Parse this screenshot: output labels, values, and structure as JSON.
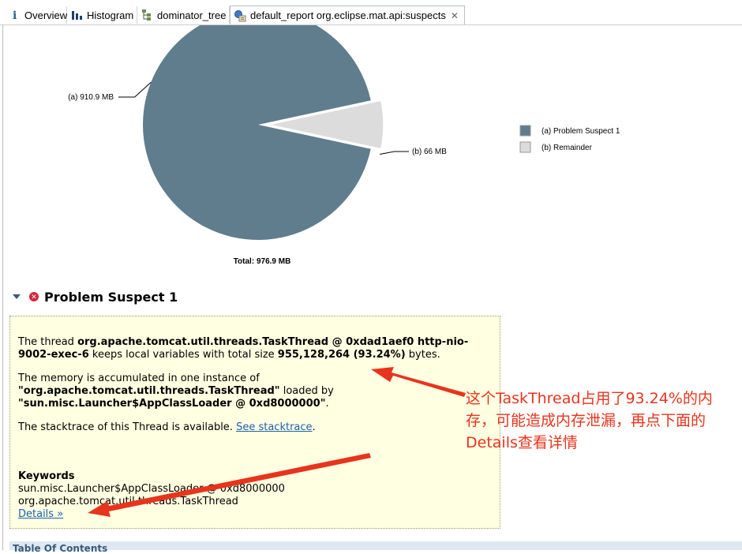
{
  "tabs": [
    {
      "label": "Overview",
      "icon": "info-icon"
    },
    {
      "label": "Histogram",
      "icon": "histogram-icon"
    },
    {
      "label": "dominator_tree",
      "icon": "tree-icon"
    },
    {
      "label": "default_report  org.eclipse.mat.api:suspects",
      "icon": "report-icon",
      "active": true,
      "closable": true
    }
  ],
  "chart": {
    "total_label": "Total: 976.9 MB",
    "colors": {
      "suspect": "#607d8d",
      "remainder": "#dcdcdc"
    }
  },
  "chart_data": {
    "type": "pie",
    "slices": [
      {
        "label": "(a)  910.9 MB",
        "legend": "(a)  Problem Suspect 1",
        "value": 910.9
      },
      {
        "label": "(b)  66 MB",
        "legend": "(b)  Remainder",
        "value": 66
      }
    ],
    "total": "Total: 976.9 MB",
    "legend_position": "right"
  },
  "problem_suspect": {
    "title": "Problem Suspect 1",
    "p1_a": "The thread ",
    "p1_b": "org.apache.tomcat.util.threads.TaskThread @ 0xdad1aef0 http-nio-9002-exec-6",
    "p1_c": " keeps local variables with total size ",
    "p1_d": "955,128,264 (93.24%)",
    "p1_e": " bytes.",
    "p2_a": "The memory is accumulated in one instance of ",
    "p2_b": "\"org.apache.tomcat.util.threads.TaskThread\"",
    "p2_c": " loaded by ",
    "p2_d": "\"sun.misc.Launcher$AppClassLoader @ 0xd8000000\"",
    "p2_e": ".",
    "p3_a": "The stacktrace of this Thread is available. ",
    "p3_link": "See stacktrace",
    "p3_e": ".",
    "keywords_title": "Keywords",
    "keyword_1": "sun.misc.Launcher$AppClassLoader @ 0xd8000000",
    "keyword_2": "org.apache.tomcat.util.threads.TaskThread",
    "details_link": "Details »"
  },
  "toc": {
    "label": "Table Of Contents"
  },
  "annotation": {
    "text": "这个TaskThread占用了93.24%的内存，可能造成内存泄漏，再点下面的Details查看详情",
    "color": "#e8341c"
  }
}
